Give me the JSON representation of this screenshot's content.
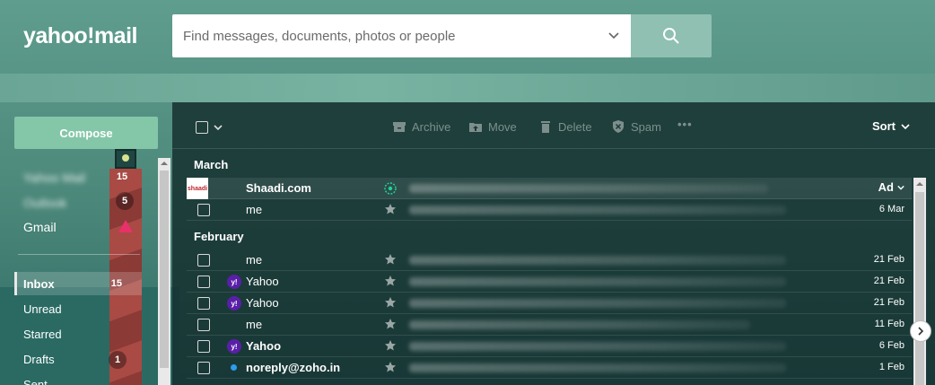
{
  "header": {
    "logo": "yahoo!mail",
    "search_placeholder": "Find messages, documents, photos or people"
  },
  "sidebar": {
    "compose_label": "Compose",
    "accounts": [
      {
        "label": "Yahoo Mail",
        "count": "15",
        "blurred": true
      },
      {
        "label": "Outlook",
        "count": "5",
        "blurred": true
      },
      {
        "label": "Gmail",
        "count": "",
        "blurred": false
      }
    ],
    "folders": [
      {
        "label": "Inbox",
        "count": "15",
        "active": true
      },
      {
        "label": "Unread",
        "count": ""
      },
      {
        "label": "Starred",
        "count": ""
      },
      {
        "label": "Drafts",
        "count": "1"
      },
      {
        "label": "Sent",
        "count": ""
      }
    ]
  },
  "toolbar": {
    "archive": "Archive",
    "move": "Move",
    "delete": "Delete",
    "spam": "Spam",
    "more": "•••",
    "sort": "Sort"
  },
  "sections": [
    {
      "label": "March",
      "rows": [
        {
          "sender": "Shaadi.com",
          "bold": true,
          "type": "ad",
          "logo": "shaadi",
          "date": "",
          "adtag": "Ad"
        },
        {
          "sender": "me",
          "bold": false,
          "type": "mail",
          "avatar": "none",
          "date": "6 Mar"
        }
      ]
    },
    {
      "label": "February",
      "rows": [
        {
          "sender": "me",
          "bold": false,
          "type": "mail",
          "avatar": "none",
          "date": "21 Feb"
        },
        {
          "sender": "Yahoo",
          "bold": false,
          "type": "mail",
          "avatar": "yahoo",
          "date": "21 Feb"
        },
        {
          "sender": "Yahoo",
          "bold": false,
          "type": "mail",
          "avatar": "yahoo",
          "date": "21 Feb"
        },
        {
          "sender": "me",
          "bold": false,
          "type": "mail",
          "avatar": "none",
          "date": "11 Feb"
        },
        {
          "sender": "Yahoo",
          "bold": true,
          "type": "mail",
          "avatar": "yahoo",
          "date": "6 Feb"
        },
        {
          "sender": "noreply@zoho.in",
          "bold": true,
          "type": "mail",
          "avatar": "dot",
          "date": "1 Feb"
        }
      ]
    }
  ],
  "colors": {
    "compose": "#84c7a8",
    "yahoo_purple": "#5a1fa8",
    "unread_dot": "#2e9bf0",
    "sponsored_green": "#1fd39a",
    "gmail_triangle": "#e8316a"
  }
}
